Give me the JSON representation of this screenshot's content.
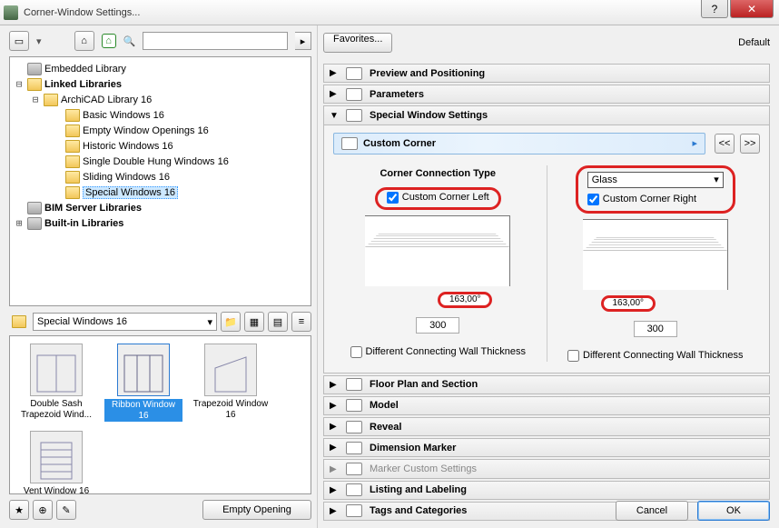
{
  "window": {
    "title": "Corner-Window Settings..."
  },
  "toolbar": {
    "search_placeholder": ""
  },
  "tree": {
    "root1": "Embedded Library",
    "root2": "Linked Libraries",
    "lib": "ArchiCAD Library 16",
    "items": [
      "Basic Windows 16",
      "Empty Window Openings 16",
      "Historic Windows 16",
      "Single Double Hung Windows 16",
      "Sliding Windows 16",
      "Special Windows 16"
    ],
    "root3": "BIM Server Libraries",
    "root4": "Built-in Libraries"
  },
  "path": {
    "current": "Special Windows 16"
  },
  "thumbs": [
    {
      "label": "Double Sash Trapezoid Wind..."
    },
    {
      "label": "Ribbon Window 16"
    },
    {
      "label": "Trapezoid Window 16"
    },
    {
      "label": "Vent Window 16"
    }
  ],
  "bottom": {
    "empty_opening": "Empty Opening"
  },
  "favorites": {
    "button": "Favorites...",
    "default": "Default"
  },
  "sections": {
    "preview": "Preview and Positioning",
    "parameters": "Parameters",
    "special": "Special Window Settings",
    "floorplan": "Floor Plan and Section",
    "model": "Model",
    "reveal": "Reveal",
    "dimension": "Dimension Marker",
    "marker": "Marker Custom Settings",
    "listing": "Listing and Labeling",
    "tags": "Tags and Categories"
  },
  "special": {
    "bar_label": "Custom Corner",
    "prev": "<<",
    "next": ">>",
    "left": {
      "header": "Corner Connection Type",
      "checkbox": "Custom Corner Left",
      "angle": "163,00°",
      "dim": "300",
      "thickness": "Different Connecting Wall Thickness"
    },
    "right": {
      "glass": "Glass",
      "checkbox": "Custom Corner Right",
      "angle": "163,00°",
      "dim": "300",
      "thickness": "Different Connecting Wall Thickness"
    }
  },
  "buttons": {
    "cancel": "Cancel",
    "ok": "OK"
  }
}
